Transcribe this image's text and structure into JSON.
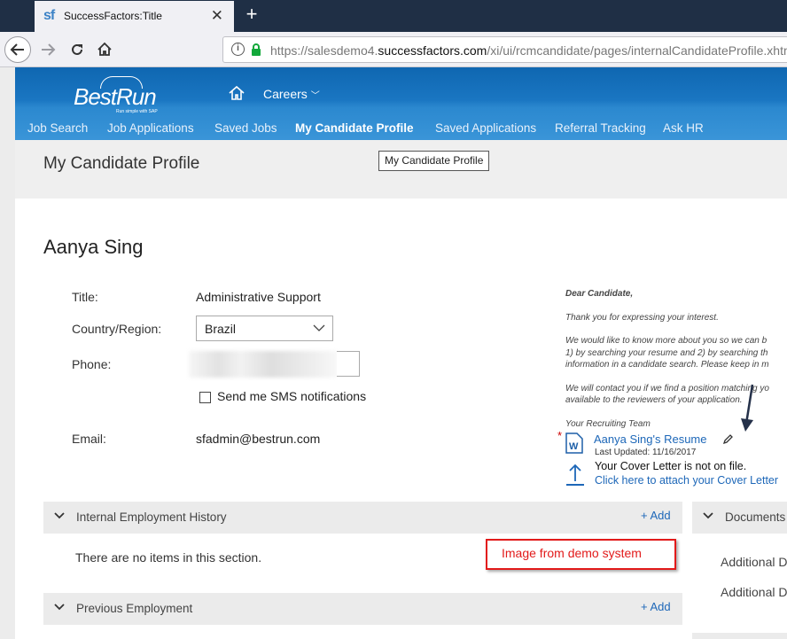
{
  "browser": {
    "tab_title": "SuccessFactors:Title",
    "favicon_text": "sf",
    "url_host_prefix": "https://salesdemo4.",
    "url_host_domain": "successfactors.com",
    "url_path": "/xi/ui/rcmcandidate/pages/internalCandidateProfile.xhtml?"
  },
  "header": {
    "logo_text": "BestRun",
    "logo_tagline": "Run simple with SAP",
    "careers_label": "Careers",
    "menu": [
      {
        "label": "Job Search"
      },
      {
        "label": "Job Applications"
      },
      {
        "label": "Saved Jobs"
      },
      {
        "label": "My Candidate Profile",
        "active": true
      },
      {
        "label": "Saved Applications"
      },
      {
        "label": "Referral Tracking"
      },
      {
        "label": "Ask HR"
      }
    ]
  },
  "page": {
    "title": "My Candidate Profile",
    "tooltip": "My Candidate Profile"
  },
  "profile": {
    "name": "Aanya Sing",
    "title_label": "Title:",
    "title_value": "Administrative Support",
    "country_label": "Country/Region:",
    "country_value": "Brazil",
    "phone_label": "Phone:",
    "sms_label": "Send me SMS notifications",
    "email_label": "Email:",
    "email_value": "sfadmin@bestrun.com"
  },
  "letter": {
    "greeting": "Dear Candidate,",
    "line1": "Thank you for expressing your interest.",
    "line2": "We would like to know more about you so we can b",
    "line3": "1) by searching your resume and 2) by searching th",
    "line4": "information in a candidate search. Please keep in m",
    "line5": "We will contact you if we find a position matching yo",
    "line6": "available to the reviewers of your application.",
    "signoff": "Your Recruiting Team"
  },
  "attachments": {
    "required_mark": "*",
    "resume_link": "Aanya Sing's Resume",
    "resume_updated": "Last Updated: 11/16/2017",
    "cover_letter_status": "Your Cover Letter is not on file.",
    "cover_letter_link": "Click here to attach your Cover Letter"
  },
  "sections": {
    "internal_history": {
      "title": "Internal Employment History",
      "add_label": "+ Add",
      "empty_text": "There are no items in this section."
    },
    "previous_employment": {
      "title": "Previous Employment",
      "add_label": "+ Add"
    },
    "documents": {
      "title": "Documents",
      "line1": "Additional D",
      "line2": "Additional D"
    }
  },
  "annotation": {
    "text": "Image from demo system",
    "color": "#e21a1a"
  },
  "colors": {
    "header_blue": "#1a76c2",
    "link_blue": "#1d67b8",
    "tabbar": "#1f2f45"
  }
}
